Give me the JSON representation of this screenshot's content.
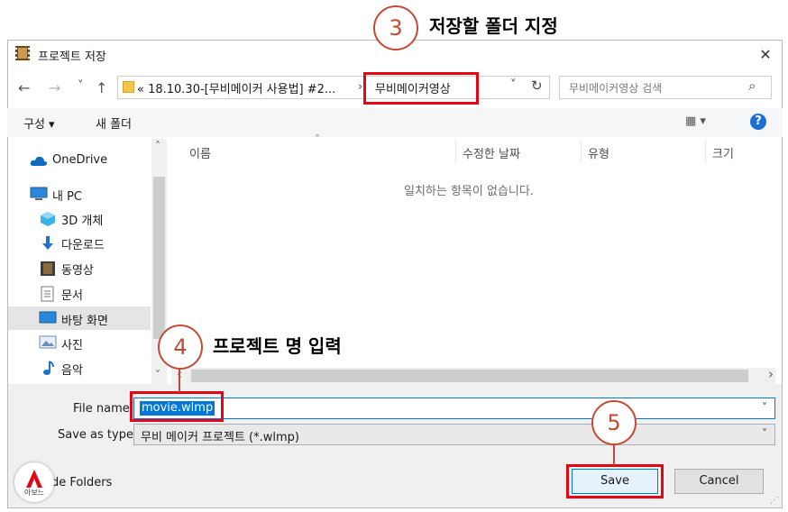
{
  "window": {
    "title": "프로젝트 저장",
    "close_glyph": "✕"
  },
  "nav": {
    "back_glyph": "←",
    "forward_glyph": "→",
    "recent_glyph": "˅",
    "up_glyph": "↑",
    "address_path": "« 18.10.30-[무비메이커 사용법] #2...",
    "address_separator": "›",
    "address_current": "무비메이커영상",
    "address_dropdown_glyph": "˅",
    "refresh_glyph": "↻",
    "search_placeholder": "무비메이커영상 검색",
    "search_glyph": "⌕"
  },
  "toolbar": {
    "organize_label": "구성 ▾",
    "new_folder_label": "새 폴더",
    "view_glyph": "▦ ▾",
    "help_glyph": "?"
  },
  "sidebar": {
    "items": [
      {
        "label": "OneDrive",
        "icon": "cloud-icon"
      },
      {
        "label": "내 PC",
        "icon": "computer-icon"
      },
      {
        "label": "3D 개체",
        "icon": "cube-icon"
      },
      {
        "label": "다운로드",
        "icon": "download-icon"
      },
      {
        "label": "동영상",
        "icon": "film-icon"
      },
      {
        "label": "문서",
        "icon": "document-icon"
      },
      {
        "label": "바탕 화면",
        "icon": "desktop-icon"
      },
      {
        "label": "사진",
        "icon": "picture-icon"
      },
      {
        "label": "음악",
        "icon": "music-icon"
      }
    ],
    "scroll_up_glyph": "˄",
    "scroll_down_glyph": "˅"
  },
  "file_list": {
    "columns": [
      "이름",
      "수정한 날짜",
      "유형",
      "크기"
    ],
    "sort_glyph": "˄",
    "empty_message": "일치하는 항목이 없습니다.",
    "scroll_left_glyph": "‹",
    "scroll_right_glyph": "›"
  },
  "form": {
    "file_name_label": "File name:",
    "file_name_value": "movie.wlmp",
    "save_as_type_label": "Save as type:",
    "save_as_type_value": "무비 메이커 프로젝트 (*.wlmp)",
    "dropdown_glyph": "˅",
    "hide_folders_label": "de Folders",
    "save_button": "Save",
    "cancel_button": "Cancel"
  },
  "annotations": {
    "step3_number": "3",
    "step3_text": "저장할 폴더 지정",
    "step4_number": "4",
    "step4_text": "프로젝트 명 입력",
    "step5_number": "5"
  },
  "logo": {
    "text": "아보느"
  },
  "colors": {
    "highlight_red": "#e30613",
    "annotation_circle": "#c44a35",
    "selection_blue": "#0078d7",
    "help_blue": "#1e6fd1"
  }
}
